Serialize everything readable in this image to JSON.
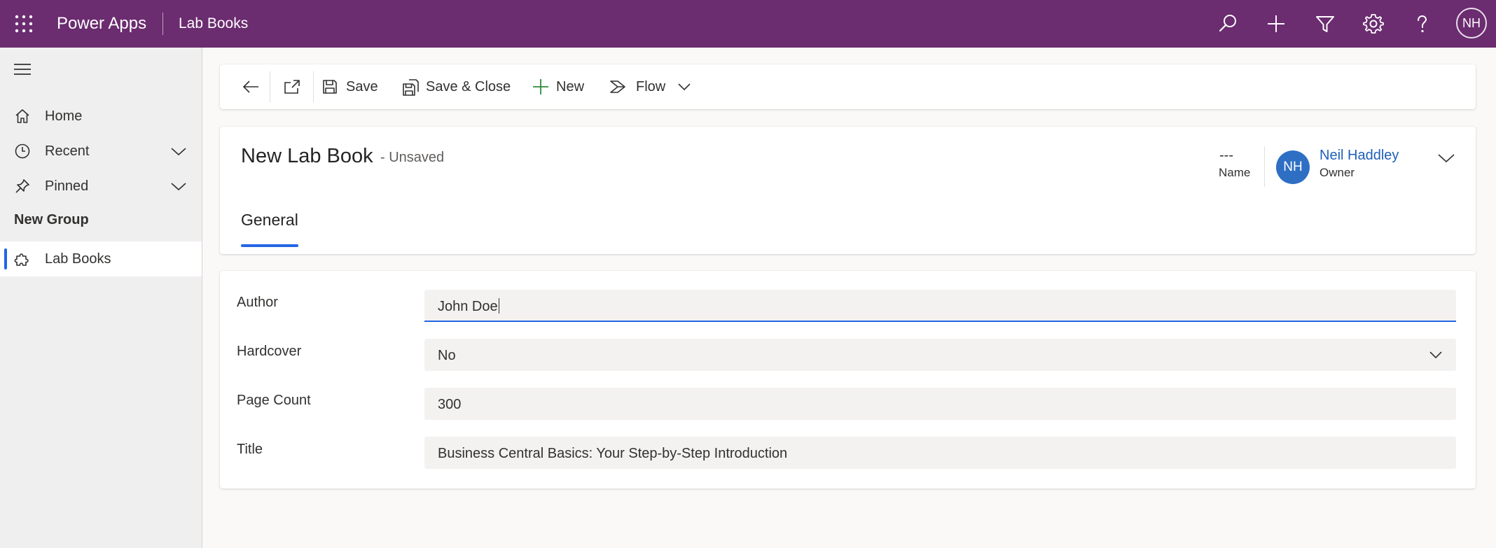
{
  "topbar": {
    "app_title": "Power Apps",
    "entity_title": "Lab Books",
    "icons": [
      "search-icon",
      "add-icon",
      "filter-icon",
      "settings-icon",
      "help-icon"
    ],
    "user_initials": "NH",
    "background_color": "#6b2c70"
  },
  "sidebar": {
    "items": [
      {
        "label": "Home",
        "icon": "home-icon"
      },
      {
        "label": "Recent",
        "icon": "clock-icon",
        "expandable": true
      },
      {
        "label": "Pinned",
        "icon": "pin-icon",
        "expandable": true
      }
    ],
    "group_label": "New Group",
    "group_items": [
      {
        "label": "Lab Books",
        "icon": "puzzle-icon",
        "selected": true
      }
    ]
  },
  "commandbar": {
    "save_label": "Save",
    "save_close_label": "Save & Close",
    "new_label": "New",
    "flow_label": "Flow"
  },
  "record": {
    "title": "New Lab Book",
    "status": "- Unsaved",
    "name_value": "---",
    "name_label": "Name",
    "owner_initials": "NH",
    "owner_name": "Neil Haddley",
    "owner_label": "Owner",
    "tabs": [
      {
        "label": "General",
        "selected": true
      }
    ]
  },
  "form": {
    "fields": [
      {
        "label": "Author",
        "value": "John Doe",
        "focused": true
      },
      {
        "label": "Hardcover",
        "value": "No",
        "type": "select"
      },
      {
        "label": "Page Count",
        "value": "300"
      },
      {
        "label": "Title",
        "value": "Business Central Basics: Your Step-by-Step Introduction"
      }
    ]
  },
  "colors": {
    "accent": "#2266e3",
    "owner_link": "#1f5fb8",
    "avatar": "#2e6fc4"
  }
}
